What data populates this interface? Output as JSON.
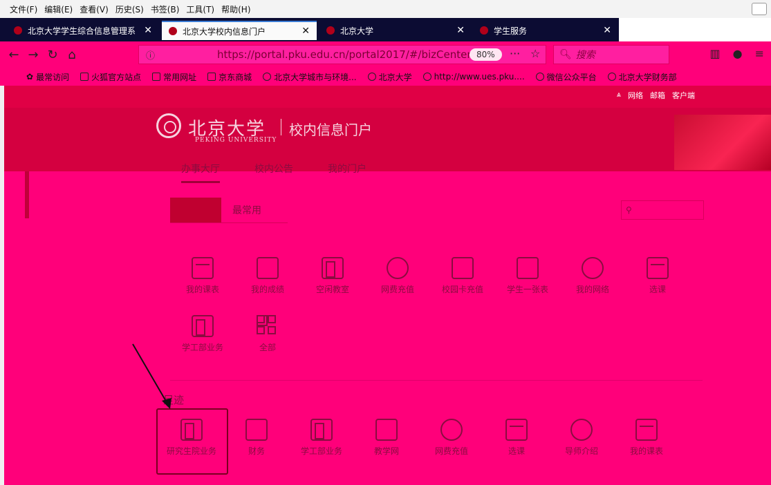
{
  "menubar": {
    "items": [
      "文件(F)",
      "编辑(E)",
      "查看(V)",
      "历史(S)",
      "书签(B)",
      "工具(T)",
      "帮助(H)"
    ]
  },
  "tabs": [
    {
      "label": "北京大学学生综合信息管理系",
      "close": "✕",
      "active": false
    },
    {
      "label": "北京大学校内信息门户",
      "close": "✕",
      "active": true
    },
    {
      "label": "北京大学",
      "close": "✕",
      "active": false
    },
    {
      "label": "学生服务",
      "close": "✕",
      "active": false
    }
  ],
  "navbar": {
    "url": "https://portal.pku.edu.cn/portal2017/#/bizCenter",
    "zoom": "80%",
    "more": "···",
    "star": "☆",
    "search_placeholder": "搜索"
  },
  "bookmarks": [
    "最常访问",
    "火狐官方站点",
    "常用网址",
    "京东商城",
    "北京大学城市与环境...",
    "北京大学",
    "http://www.ues.pku....",
    "微信公众平台",
    "北京大学财务部"
  ],
  "toplinks": [
    "网络",
    "邮箱",
    "客户端"
  ],
  "banner": {
    "logo_cn": "北京大学",
    "logo_en": "PEKING UNIVERSITY",
    "portal": "校内信息门户"
  },
  "navtabs": [
    "办事大厅",
    "校内公告",
    "我的门户"
  ],
  "subtabs": [
    "",
    "最常用"
  ],
  "apps_row1": [
    "我的课表",
    "我的成绩",
    "空闲教室",
    "网费充值",
    "校园卡充值",
    "学生一张表",
    "我的网络",
    "选课"
  ],
  "apps_row2": [
    "学工部业务",
    "全部"
  ],
  "section_title": "足迹",
  "footprints": [
    "研究生院业务",
    "财务",
    "学工部业务",
    "教学网",
    "网费充值",
    "选课",
    "导师介绍",
    "我的课表"
  ]
}
